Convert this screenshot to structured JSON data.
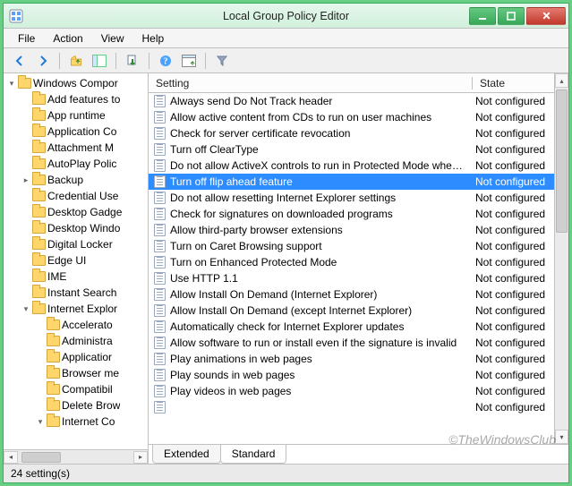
{
  "window": {
    "title": "Local Group Policy Editor"
  },
  "menu": {
    "items": [
      "File",
      "Action",
      "View",
      "Help"
    ]
  },
  "tree": {
    "items": [
      {
        "depth": 0,
        "exp": "▾",
        "label": "Windows Compor"
      },
      {
        "depth": 1,
        "exp": "",
        "label": "Add features to"
      },
      {
        "depth": 1,
        "exp": "",
        "label": "App runtime"
      },
      {
        "depth": 1,
        "exp": "",
        "label": "Application Co"
      },
      {
        "depth": 1,
        "exp": "",
        "label": "Attachment M"
      },
      {
        "depth": 1,
        "exp": "",
        "label": "AutoPlay Polic"
      },
      {
        "depth": 1,
        "exp": "▸",
        "label": "Backup"
      },
      {
        "depth": 1,
        "exp": "",
        "label": "Credential Use"
      },
      {
        "depth": 1,
        "exp": "",
        "label": "Desktop Gadge"
      },
      {
        "depth": 1,
        "exp": "",
        "label": "Desktop Windo"
      },
      {
        "depth": 1,
        "exp": "",
        "label": "Digital Locker"
      },
      {
        "depth": 1,
        "exp": "",
        "label": "Edge UI"
      },
      {
        "depth": 1,
        "exp": "",
        "label": "IME"
      },
      {
        "depth": 1,
        "exp": "",
        "label": "Instant Search"
      },
      {
        "depth": 1,
        "exp": "▾",
        "label": "Internet Explor"
      },
      {
        "depth": 2,
        "exp": "",
        "label": "Accelerato"
      },
      {
        "depth": 2,
        "exp": "",
        "label": "Administra"
      },
      {
        "depth": 2,
        "exp": "",
        "label": "Applicatior"
      },
      {
        "depth": 2,
        "exp": "",
        "label": "Browser me"
      },
      {
        "depth": 2,
        "exp": "",
        "label": "Compatibil"
      },
      {
        "depth": 2,
        "exp": "",
        "label": "Delete Brow"
      },
      {
        "depth": 2,
        "exp": "▾",
        "label": "Internet Co"
      }
    ]
  },
  "list": {
    "columns": {
      "setting": "Setting",
      "state": "State"
    },
    "rows": [
      {
        "name": "Always send Do Not Track header",
        "state": "Not configured",
        "selected": false
      },
      {
        "name": "Allow active content from CDs to run on user machines",
        "state": "Not configured",
        "selected": false
      },
      {
        "name": "Check for server certificate revocation",
        "state": "Not configured",
        "selected": false
      },
      {
        "name": "Turn off ClearType",
        "state": "Not configured",
        "selected": false
      },
      {
        "name": "Do not allow ActiveX controls to run in Protected Mode whe…",
        "state": "Not configured",
        "selected": false
      },
      {
        "name": "Turn off flip ahead feature",
        "state": "Not configured",
        "selected": true
      },
      {
        "name": "Do not allow resetting Internet Explorer settings",
        "state": "Not configured",
        "selected": false
      },
      {
        "name": "Check for signatures on downloaded programs",
        "state": "Not configured",
        "selected": false
      },
      {
        "name": "Allow third-party browser extensions",
        "state": "Not configured",
        "selected": false
      },
      {
        "name": "Turn on Caret Browsing support",
        "state": "Not configured",
        "selected": false
      },
      {
        "name": "Turn on Enhanced Protected Mode",
        "state": "Not configured",
        "selected": false
      },
      {
        "name": "Use HTTP 1.1",
        "state": "Not configured",
        "selected": false
      },
      {
        "name": "Allow Install On Demand (Internet Explorer)",
        "state": "Not configured",
        "selected": false
      },
      {
        "name": "Allow Install On Demand (except Internet Explorer)",
        "state": "Not configured",
        "selected": false
      },
      {
        "name": "Automatically check for Internet Explorer updates",
        "state": "Not configured",
        "selected": false
      },
      {
        "name": "Allow software to run or install even if the signature is invalid",
        "state": "Not configured",
        "selected": false
      },
      {
        "name": "Play animations in web pages",
        "state": "Not configured",
        "selected": false
      },
      {
        "name": "Play sounds in web pages",
        "state": "Not configured",
        "selected": false
      },
      {
        "name": "Play videos in web pages",
        "state": "Not configured",
        "selected": false
      },
      {
        "name": "",
        "state": "Not configured",
        "selected": false
      }
    ]
  },
  "tabs": {
    "extended": "Extended",
    "standard": "Standard",
    "active": "standard"
  },
  "status": {
    "text": "24 setting(s)"
  },
  "watermark": "©TheWindowsClub"
}
